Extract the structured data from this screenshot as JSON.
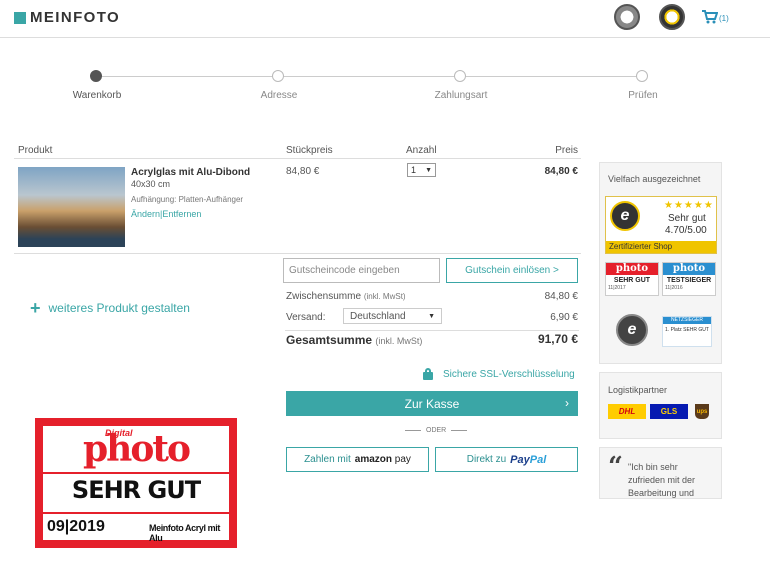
{
  "header": {
    "logo_text": "MEINFOTO",
    "cart_count": "(1)",
    "colors": {
      "brand": "#3aa6a6",
      "cart": "#2a8fb8"
    }
  },
  "steps": [
    {
      "label": "Warenkorb",
      "active": true
    },
    {
      "label": "Adresse",
      "active": false
    },
    {
      "label": "Zahlungsart",
      "active": false
    },
    {
      "label": "Prüfen",
      "active": false
    }
  ],
  "table": {
    "headers": {
      "product": "Produkt",
      "unit_price": "Stückpreis",
      "qty": "Anzahl",
      "price": "Preis"
    }
  },
  "item": {
    "name": "Acrylglas mit Alu-Dibond",
    "size": "40x30 cm",
    "hanger": "Aufhängung: Platten-Aufhänger",
    "edit_link": "Ändern",
    "separator": "|",
    "remove_link": "Entfernen",
    "unit_price": "84,80 €",
    "qty": "1",
    "price": "84,80 €"
  },
  "add_product": "weiteres Produkt gestalten",
  "coupon": {
    "placeholder": "Gutscheincode eingeben",
    "button": "Gutschein einlösen >"
  },
  "summary": {
    "subtotal_label": "Zwischensumme",
    "subtotal_note": "(inkl. MwSt)",
    "subtotal_value": "84,80 €",
    "shipping_label": "Versand:",
    "shipping_country": "Deutschland",
    "shipping_value": "6,90 €",
    "total_label": "Gesamtsumme",
    "total_note": "(inkl. MwSt)",
    "total_value": "91,70 €"
  },
  "ssl": "Sichere SSL-Verschlüsselung",
  "checkout": {
    "label": "Zur Kasse",
    "chevron": "›"
  },
  "or_label": "ODER",
  "amazon_pay": {
    "prefix": "Zahlen mit",
    "brand": "amazon",
    "brand_suffix": "pay"
  },
  "paypal": {
    "prefix": "Direkt zu",
    "brand_a": "Pay",
    "brand_b": "Pal"
  },
  "award": {
    "digital": "Digital",
    "photo": "photo",
    "grade": "SEHR GUT",
    "date": "09|2019",
    "product": "Meinfoto Acryl mit Alu"
  },
  "sidebar": {
    "awards_title": "Vielfach ausgezeichnet",
    "ts": {
      "seal": "e",
      "stars": "★★★★★",
      "grade": "Sehr gut",
      "score": "4.70/5.00",
      "bar": "Zertifizierter Shop"
    },
    "mini_awards": [
      {
        "head": "photo",
        "body": "SEHR GUT",
        "foot": "11|2017",
        "color": "#e5202b"
      },
      {
        "head": "photo",
        "body": "TESTSIEGER",
        "foot": "11|2016",
        "color": "#2a8fd0"
      }
    ],
    "ts_small_seal": "e",
    "netz": {
      "head": "NETZSIEGER",
      "body": "1. Platz SEHR GUT"
    },
    "logistics_title": "Logistikpartner",
    "logistics": [
      {
        "label": "DHL",
        "bg": "#ffcc00",
        "fg": "#d40511"
      },
      {
        "label": "GLS",
        "bg": "#061ab1",
        "fg": "#ffd100"
      },
      {
        "label": "ups",
        "bg": "#5a3a1a",
        "fg": "#f5b400"
      }
    ],
    "quote_mark": "“",
    "quote": "\"Ich bin sehr zufrieden mit der Bearbeitung und"
  }
}
